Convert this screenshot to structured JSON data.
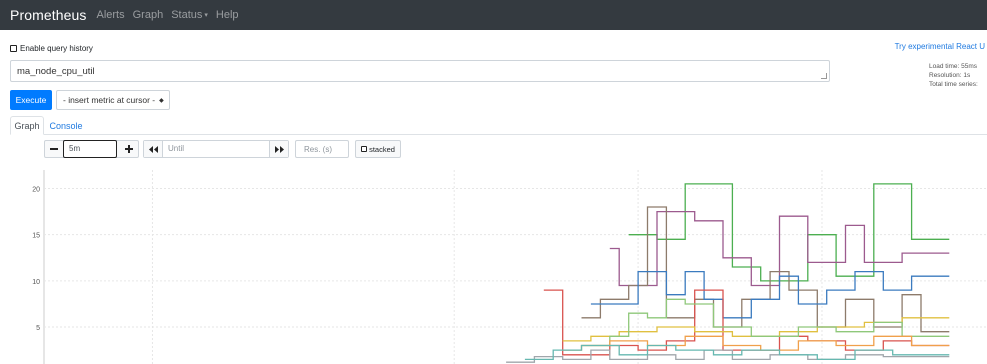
{
  "navbar": {
    "brand": "Prometheus",
    "links": [
      "Alerts",
      "Graph",
      "Status",
      "Help"
    ],
    "status_caret": "▾"
  },
  "query_history": {
    "label": "Enable query history",
    "checked": false
  },
  "try_react": "Try experimental React U",
  "expression": {
    "value": "ma_node_cpu_util"
  },
  "load_info": {
    "load_time": "Load time: 55ms",
    "resolution": "Resolution: 1s",
    "total_series": "Total time series:"
  },
  "execute_label": "Execute",
  "metric_select": {
    "selected": "- insert metric at cursor -"
  },
  "tabs": [
    {
      "label": "Graph",
      "active": true
    },
    {
      "label": "Console",
      "active": false
    }
  ],
  "graph_controls": {
    "range_value": "5m",
    "until_placeholder": "Until",
    "resolution_placeholder": "Res. (s)",
    "stacked_label": "stacked"
  },
  "icons": {
    "minus": "minus-icon",
    "plus": "plus-icon",
    "back": "double-left-icon",
    "forward": "double-right-icon"
  },
  "chart_data": {
    "type": "line",
    "y_ticks": [
      5,
      10,
      15,
      20
    ],
    "ylim": [
      1,
      22
    ],
    "xlim": [
      0,
      100
    ],
    "grid": true,
    "series": [
      {
        "color": "#4caf50",
        "points": [
          [
            62,
            15
          ],
          [
            65,
            15
          ],
          [
            65,
            14.5
          ],
          [
            68,
            14.5
          ],
          [
            68,
            20.5
          ],
          [
            73,
            20.5
          ],
          [
            73,
            11.5
          ],
          [
            76,
            11.5
          ],
          [
            76,
            10
          ],
          [
            81,
            10
          ],
          [
            81,
            15
          ],
          [
            84,
            15
          ],
          [
            84,
            10.5
          ],
          [
            88,
            10.5
          ],
          [
            88,
            20.5
          ],
          [
            92,
            20.5
          ],
          [
            92,
            14.5
          ],
          [
            96,
            14.5
          ],
          [
            96,
            14.5
          ]
        ]
      },
      {
        "color": "#9c5a8e",
        "points": [
          [
            60,
            13.5
          ],
          [
            61,
            13.5
          ],
          [
            61,
            9.5
          ],
          [
            65,
            9.5
          ],
          [
            65,
            17.5
          ],
          [
            69,
            17.5
          ],
          [
            69,
            16.5
          ],
          [
            72,
            16.5
          ],
          [
            72,
            12.5
          ],
          [
            75,
            12.5
          ],
          [
            75,
            9.5
          ],
          [
            78,
            9.5
          ],
          [
            78,
            17
          ],
          [
            81,
            17
          ],
          [
            81,
            12
          ],
          [
            85,
            12
          ],
          [
            85,
            16
          ],
          [
            87,
            16
          ],
          [
            87,
            12
          ],
          [
            91,
            12
          ],
          [
            91,
            13
          ],
          [
            96,
            13
          ]
        ]
      },
      {
        "color": "#8d7b6b",
        "points": [
          [
            57,
            6
          ],
          [
            59,
            6
          ],
          [
            59,
            8
          ],
          [
            62,
            8
          ],
          [
            62,
            9.5
          ],
          [
            64,
            9.5
          ],
          [
            64,
            18
          ],
          [
            66,
            18
          ],
          [
            66,
            6
          ],
          [
            69,
            6
          ],
          [
            69,
            8
          ],
          [
            71,
            8
          ],
          [
            71,
            5
          ],
          [
            74,
            5
          ],
          [
            74,
            8
          ],
          [
            77,
            8
          ],
          [
            77,
            11
          ],
          [
            79,
            11
          ],
          [
            79,
            9
          ],
          [
            82,
            9
          ],
          [
            82,
            5
          ],
          [
            85,
            5
          ],
          [
            85,
            8
          ],
          [
            88,
            8
          ],
          [
            88,
            5
          ],
          [
            91,
            5
          ],
          [
            91,
            8.5
          ],
          [
            93,
            8.5
          ],
          [
            93,
            4.5
          ],
          [
            96,
            4.5
          ]
        ]
      },
      {
        "color": "#3b7bbf",
        "points": [
          [
            58,
            7.5
          ],
          [
            61,
            7.5
          ],
          [
            61,
            7.5
          ],
          [
            63,
            7.5
          ],
          [
            63,
            11
          ],
          [
            66,
            11
          ],
          [
            66,
            8.5
          ],
          [
            68,
            8.5
          ],
          [
            68,
            11
          ],
          [
            70,
            11
          ],
          [
            70,
            8
          ],
          [
            72,
            8
          ],
          [
            72,
            6
          ],
          [
            75,
            6
          ],
          [
            75,
            8
          ],
          [
            78,
            8
          ],
          [
            78,
            10.5
          ],
          [
            80,
            10.5
          ],
          [
            80,
            7.5
          ],
          [
            83,
            7.5
          ],
          [
            83,
            9
          ],
          [
            86,
            9
          ],
          [
            86,
            11
          ],
          [
            89,
            11
          ],
          [
            89,
            9
          ],
          [
            92,
            9
          ],
          [
            92,
            10.5
          ],
          [
            96,
            10.5
          ]
        ]
      },
      {
        "color": "#d9534f",
        "points": [
          [
            53,
            9
          ],
          [
            55,
            9
          ],
          [
            55,
            2
          ],
          [
            60,
            2
          ],
          [
            60,
            3
          ],
          [
            63,
            3
          ],
          [
            63,
            2.5
          ],
          [
            66,
            2.5
          ],
          [
            66,
            3.5
          ],
          [
            69,
            3.5
          ],
          [
            69,
            9
          ],
          [
            72,
            9
          ],
          [
            72,
            2.5
          ],
          [
            78,
            2.5
          ],
          [
            78,
            4
          ],
          [
            81,
            4
          ],
          [
            81,
            3.5
          ],
          [
            85,
            3.5
          ],
          [
            85,
            2.5
          ],
          [
            89,
            2.5
          ],
          [
            89,
            3.5
          ],
          [
            92,
            3.5
          ],
          [
            92,
            3
          ],
          [
            96,
            3
          ]
        ]
      },
      {
        "color": "#e0c040",
        "points": [
          [
            55,
            3.5
          ],
          [
            58,
            3.5
          ],
          [
            58,
            4
          ],
          [
            61,
            4
          ],
          [
            61,
            4.5
          ],
          [
            65,
            4.5
          ],
          [
            65,
            5
          ],
          [
            69,
            5
          ],
          [
            69,
            4.5
          ],
          [
            73,
            4.5
          ],
          [
            73,
            4
          ],
          [
            78,
            4
          ],
          [
            78,
            4.5
          ],
          [
            82,
            4.5
          ],
          [
            82,
            5
          ],
          [
            87,
            5
          ],
          [
            87,
            5.5
          ],
          [
            91,
            5.5
          ],
          [
            91,
            6
          ],
          [
            96,
            6
          ]
        ]
      },
      {
        "color": "#8fc87a",
        "points": [
          [
            57,
            3
          ],
          [
            60,
            3
          ],
          [
            60,
            4
          ],
          [
            62,
            4
          ],
          [
            62,
            6.5
          ],
          [
            64,
            6.5
          ],
          [
            64,
            6
          ],
          [
            66,
            6
          ],
          [
            66,
            8
          ],
          [
            68,
            8
          ],
          [
            68,
            7.5
          ],
          [
            71,
            7.5
          ],
          [
            71,
            5
          ],
          [
            75,
            5
          ],
          [
            75,
            4
          ],
          [
            80,
            4
          ],
          [
            80,
            5
          ],
          [
            84,
            5
          ],
          [
            84,
            4.5
          ],
          [
            88,
            4.5
          ],
          [
            88,
            5.5
          ],
          [
            91,
            5.5
          ],
          [
            91,
            4
          ],
          [
            96,
            4
          ]
        ]
      },
      {
        "color": "#f0a04b",
        "points": [
          [
            55,
            2.5
          ],
          [
            57,
            2.5
          ],
          [
            57,
            3
          ],
          [
            60,
            3
          ],
          [
            60,
            3.5
          ],
          [
            64,
            3.5
          ],
          [
            64,
            3
          ],
          [
            68,
            3
          ],
          [
            68,
            4
          ],
          [
            72,
            4
          ],
          [
            72,
            3
          ],
          [
            76,
            3
          ],
          [
            76,
            2.5
          ],
          [
            80,
            2.5
          ],
          [
            80,
            3.5
          ],
          [
            84,
            3.5
          ],
          [
            84,
            3
          ],
          [
            88,
            3
          ],
          [
            88,
            4
          ],
          [
            92,
            4
          ],
          [
            92,
            3
          ],
          [
            96,
            3
          ]
        ]
      },
      {
        "color": "#a0a6ab",
        "points": [
          [
            49,
            1.2
          ],
          [
            52,
            1.2
          ],
          [
            52,
            1.8
          ],
          [
            55,
            1.8
          ],
          [
            55,
            1.5
          ],
          [
            58,
            1.5
          ],
          [
            58,
            2.5
          ],
          [
            60,
            2.5
          ],
          [
            60,
            1.5
          ],
          [
            64,
            1.5
          ],
          [
            64,
            2
          ],
          [
            67,
            2
          ],
          [
            67,
            1.5
          ],
          [
            70,
            1.5
          ],
          [
            70,
            2.5
          ],
          [
            73,
            2.5
          ],
          [
            73,
            1.5
          ],
          [
            77,
            1.5
          ],
          [
            77,
            2
          ],
          [
            81,
            2
          ],
          [
            81,
            1.5
          ],
          [
            85,
            1.5
          ],
          [
            85,
            2
          ],
          [
            89,
            2
          ],
          [
            89,
            1.8
          ],
          [
            96,
            1.8
          ]
        ]
      },
      {
        "color": "#66b8b0",
        "points": [
          [
            51,
            1.5
          ],
          [
            54,
            1.5
          ],
          [
            54,
            2.5
          ],
          [
            57,
            2.5
          ],
          [
            57,
            3
          ],
          [
            61,
            3
          ],
          [
            61,
            2
          ],
          [
            64,
            2
          ],
          [
            64,
            3
          ],
          [
            67,
            3
          ],
          [
            67,
            2.5
          ],
          [
            71,
            2.5
          ],
          [
            71,
            2
          ],
          [
            74,
            2
          ],
          [
            74,
            2.5
          ],
          [
            78,
            2.5
          ],
          [
            78,
            2
          ],
          [
            82,
            2
          ],
          [
            82,
            1.5
          ],
          [
            86,
            1.5
          ],
          [
            86,
            2.5
          ],
          [
            90,
            2.5
          ],
          [
            90,
            2
          ],
          [
            96,
            2
          ]
        ]
      }
    ]
  }
}
